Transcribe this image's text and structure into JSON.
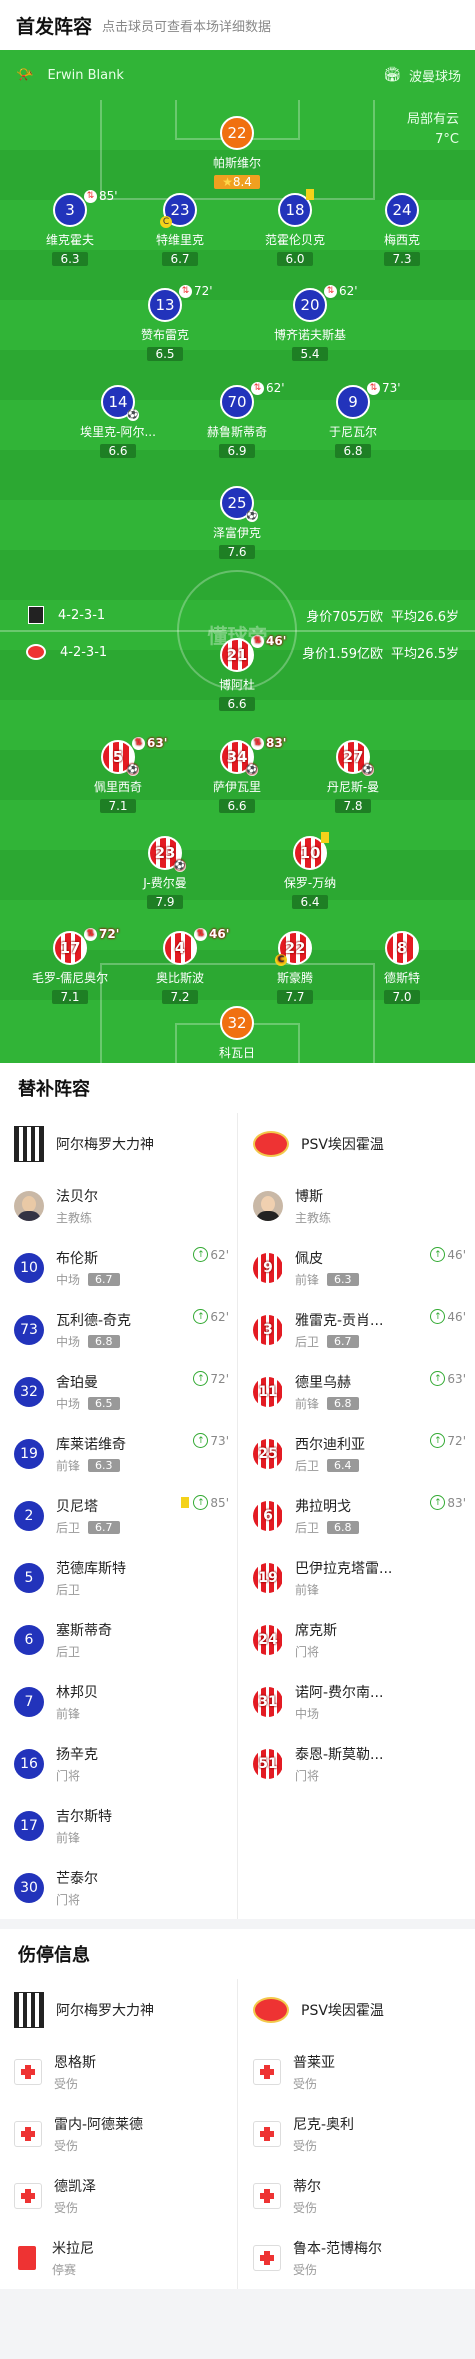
{
  "header": {
    "title": "首发阵容",
    "subtitle": "点击球员可查看本场详细数据"
  },
  "pitch_info": {
    "referee": "Erwin Blank",
    "stadium": "波曼球场",
    "weather": "局部有云",
    "temperature": "7°C",
    "watermark": "懂球帝",
    "home_formation": "4-2-3-1",
    "home_value": "身价705万欧",
    "home_age": "平均26.6岁",
    "away_formation": "4-2-3-1",
    "away_value": "身价1.59亿欧",
    "away_age": "平均26.5岁"
  },
  "home_players": [
    {
      "num": "22",
      "name": "帕斯维尔",
      "rating": "8.4",
      "star": true,
      "gk": true
    },
    {
      "num": "3",
      "name": "维克霍夫",
      "rating": "6.3",
      "sub": "85'"
    },
    {
      "num": "23",
      "name": "特维里克",
      "rating": "6.7",
      "captain": true
    },
    {
      "num": "18",
      "name": "范霍伦贝克",
      "rating": "6.0",
      "yellow": true
    },
    {
      "num": "24",
      "name": "梅西克",
      "rating": "7.3"
    },
    {
      "num": "13",
      "name": "赞布雷克",
      "rating": "6.5",
      "sub": "72'"
    },
    {
      "num": "20",
      "name": "博齐诺夫斯基",
      "rating": "5.4",
      "sub": "62'"
    },
    {
      "num": "14",
      "name": "埃里克-阿尔...",
      "rating": "6.6",
      "ball": true
    },
    {
      "num": "70",
      "name": "赫鲁斯蒂奇",
      "rating": "6.9",
      "sub": "62'"
    },
    {
      "num": "9",
      "name": "于尼瓦尔",
      "rating": "6.8",
      "sub": "73'"
    },
    {
      "num": "25",
      "name": "泽富伊克",
      "rating": "7.6",
      "ball": true
    }
  ],
  "away_players": [
    {
      "num": "21",
      "name": "博阿杜",
      "rating": "6.6",
      "sub": "46'"
    },
    {
      "num": "5",
      "name": "佩里西奇",
      "rating": "7.1",
      "sub": "63'",
      "ball": true
    },
    {
      "num": "34",
      "name": "萨伊瓦里",
      "rating": "6.6",
      "sub": "83'",
      "ball": true
    },
    {
      "num": "27",
      "name": "丹尼斯-曼",
      "rating": "7.8",
      "ball": true
    },
    {
      "num": "23",
      "name": "J-费尔曼",
      "rating": "7.9",
      "ball": true
    },
    {
      "num": "10",
      "name": "保罗-万纳",
      "rating": "6.4",
      "yellow": true
    },
    {
      "num": "17",
      "name": "毛罗-儒尼奥尔",
      "rating": "7.1",
      "sub": "72'"
    },
    {
      "num": "4",
      "name": "奥比斯波",
      "rating": "7.2",
      "sub": "46'"
    },
    {
      "num": "22",
      "name": "斯豪腾",
      "rating": "7.7",
      "captain": true
    },
    {
      "num": "8",
      "name": "德斯特",
      "rating": "7.0"
    },
    {
      "num": "32",
      "name": "科瓦日",
      "rating": "7.6",
      "gk": true
    }
  ],
  "bench": {
    "title": "替补阵容",
    "home_team": "阿尔梅罗大力神",
    "away_team": "PSV埃因霍温",
    "home_coach": {
      "name": "法贝尔",
      "role": "主教练"
    },
    "away_coach": {
      "name": "博斯",
      "role": "主教练"
    },
    "home_subs": [
      {
        "num": "10",
        "name": "布伦斯",
        "pos": "中场",
        "rating": "6.7",
        "in": "62'"
      },
      {
        "num": "73",
        "name": "瓦利德-奇克",
        "pos": "中场",
        "rating": "6.8",
        "in": "62'"
      },
      {
        "num": "32",
        "name": "舍珀曼",
        "pos": "中场",
        "rating": "6.5",
        "in": "72'"
      },
      {
        "num": "19",
        "name": "库莱诺维奇",
        "pos": "前锋",
        "rating": "6.3",
        "in": "73'"
      },
      {
        "num": "2",
        "name": "贝尼塔",
        "pos": "后卫",
        "rating": "6.7",
        "in": "85'",
        "yellow": true
      },
      {
        "num": "5",
        "name": "范德库斯特",
        "pos": "后卫"
      },
      {
        "num": "6",
        "name": "塞斯蒂奇",
        "pos": "后卫"
      },
      {
        "num": "7",
        "name": "林邦贝",
        "pos": "前锋"
      },
      {
        "num": "16",
        "name": "扬辛克",
        "pos": "门将"
      },
      {
        "num": "17",
        "name": "吉尔斯特",
        "pos": "前锋"
      },
      {
        "num": "30",
        "name": "芒泰尔",
        "pos": "门将"
      }
    ],
    "away_subs": [
      {
        "num": "9",
        "name": "佩皮",
        "pos": "前锋",
        "rating": "6.3",
        "in": "46'"
      },
      {
        "num": "3",
        "name": "雅雷克-贡肖...",
        "pos": "后卫",
        "rating": "6.7",
        "in": "46'"
      },
      {
        "num": "11",
        "name": "德里乌赫",
        "pos": "前锋",
        "rating": "6.8",
        "in": "63'"
      },
      {
        "num": "25",
        "name": "西尔迪利亚",
        "pos": "后卫",
        "rating": "6.4",
        "in": "72'"
      },
      {
        "num": "6",
        "name": "弗拉明戈",
        "pos": "后卫",
        "rating": "6.8",
        "in": "83'"
      },
      {
        "num": "19",
        "name": "巴伊拉克塔雷...",
        "pos": "前锋"
      },
      {
        "num": "24",
        "name": "席克斯",
        "pos": "门将"
      },
      {
        "num": "31",
        "name": "诺阿-费尔南...",
        "pos": "中场"
      },
      {
        "num": "51",
        "name": "泰恩-斯莫勒...",
        "pos": "门将"
      }
    ]
  },
  "injuries": {
    "title": "伤停信息",
    "home_team": "阿尔梅罗大力神",
    "away_team": "PSV埃因霍温",
    "home": [
      {
        "name": "恩格斯",
        "status": "受伤"
      },
      {
        "name": "雷内-阿德莱德",
        "status": "受伤"
      },
      {
        "name": "德凯泽",
        "status": "受伤"
      },
      {
        "name": "米拉尼",
        "status": "停赛"
      }
    ],
    "away": [
      {
        "name": "普莱亚",
        "status": "受伤"
      },
      {
        "name": "尼克-奥利",
        "status": "受伤"
      },
      {
        "name": "蒂尔",
        "status": "受伤"
      },
      {
        "name": "鲁本-范博梅尔",
        "status": "受伤"
      }
    ]
  }
}
